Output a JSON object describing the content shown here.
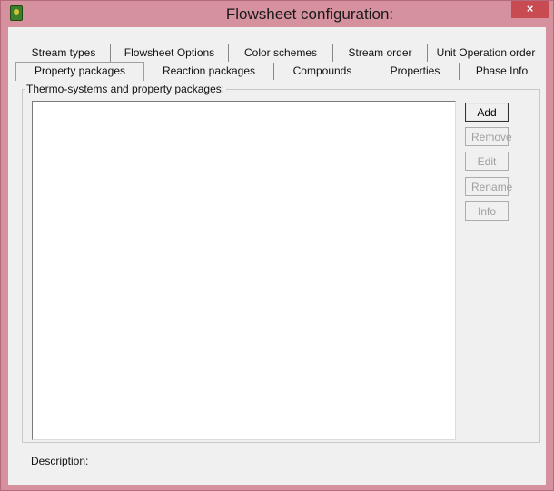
{
  "window": {
    "title": "Flowsheet configuration:",
    "close_glyph": "×"
  },
  "tabs": {
    "row1": [
      "Stream types",
      "Flowsheet Options",
      "Color schemes",
      "Stream order",
      "Unit Operation order"
    ],
    "row2": [
      "Property packages",
      "Reaction packages",
      "Compounds",
      "Properties",
      "Phase Info"
    ],
    "active": "Property packages"
  },
  "group": {
    "label": "Thermo-systems and property packages:"
  },
  "buttons": {
    "add": "Add",
    "remove": "Remove",
    "edit": "Edit",
    "rename": "Rename",
    "info": "Info"
  },
  "description": {
    "label": "Description:"
  },
  "colors": {
    "frame": "#d5919d",
    "close": "#c74b50",
    "client": "#f0f0f0"
  },
  "icons": {
    "app": "flowsheet-app-icon",
    "close": "close-icon"
  }
}
